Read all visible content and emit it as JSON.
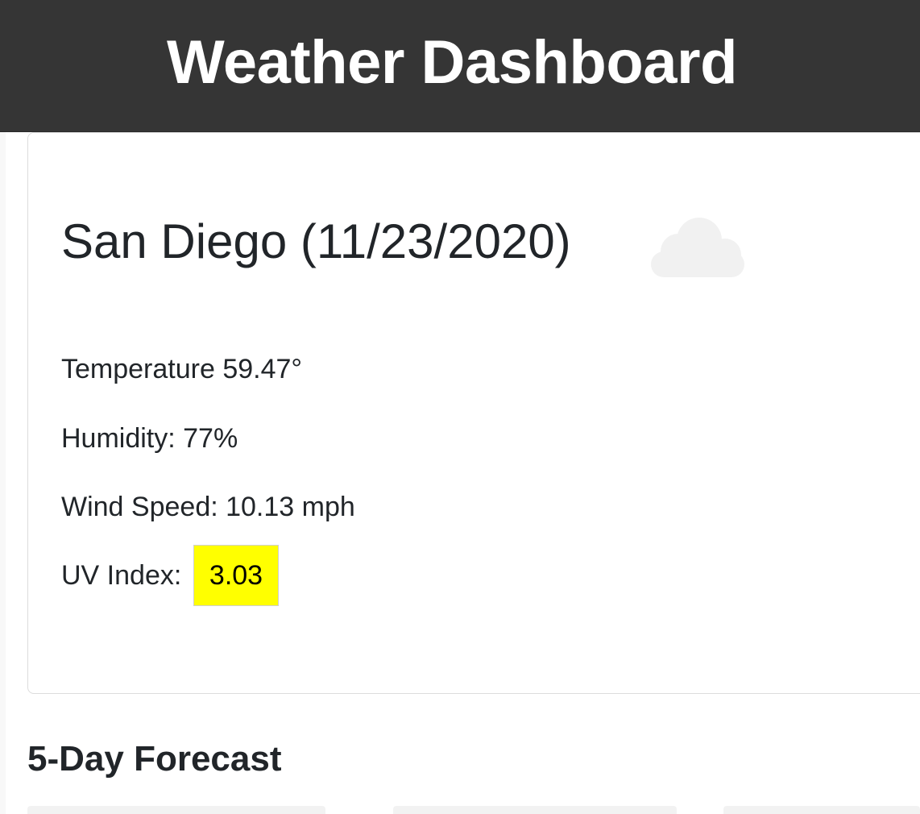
{
  "header": {
    "title": "Weather Dashboard"
  },
  "current": {
    "city_date": "San Diego (11/23/2020)",
    "icon": "cloud-icon",
    "temperature": "Temperature 59.47°",
    "humidity": "Humidity: 77%",
    "wind_speed": "Wind Speed: 10.13 mph",
    "uv_label": "UV Index:",
    "uv_value": "3.03"
  },
  "forecast": {
    "title": "5-Day Forecast"
  },
  "colors": {
    "header_bg": "#353535",
    "uv_badge": "#ffff00",
    "cloud": "#f1f1f1"
  }
}
